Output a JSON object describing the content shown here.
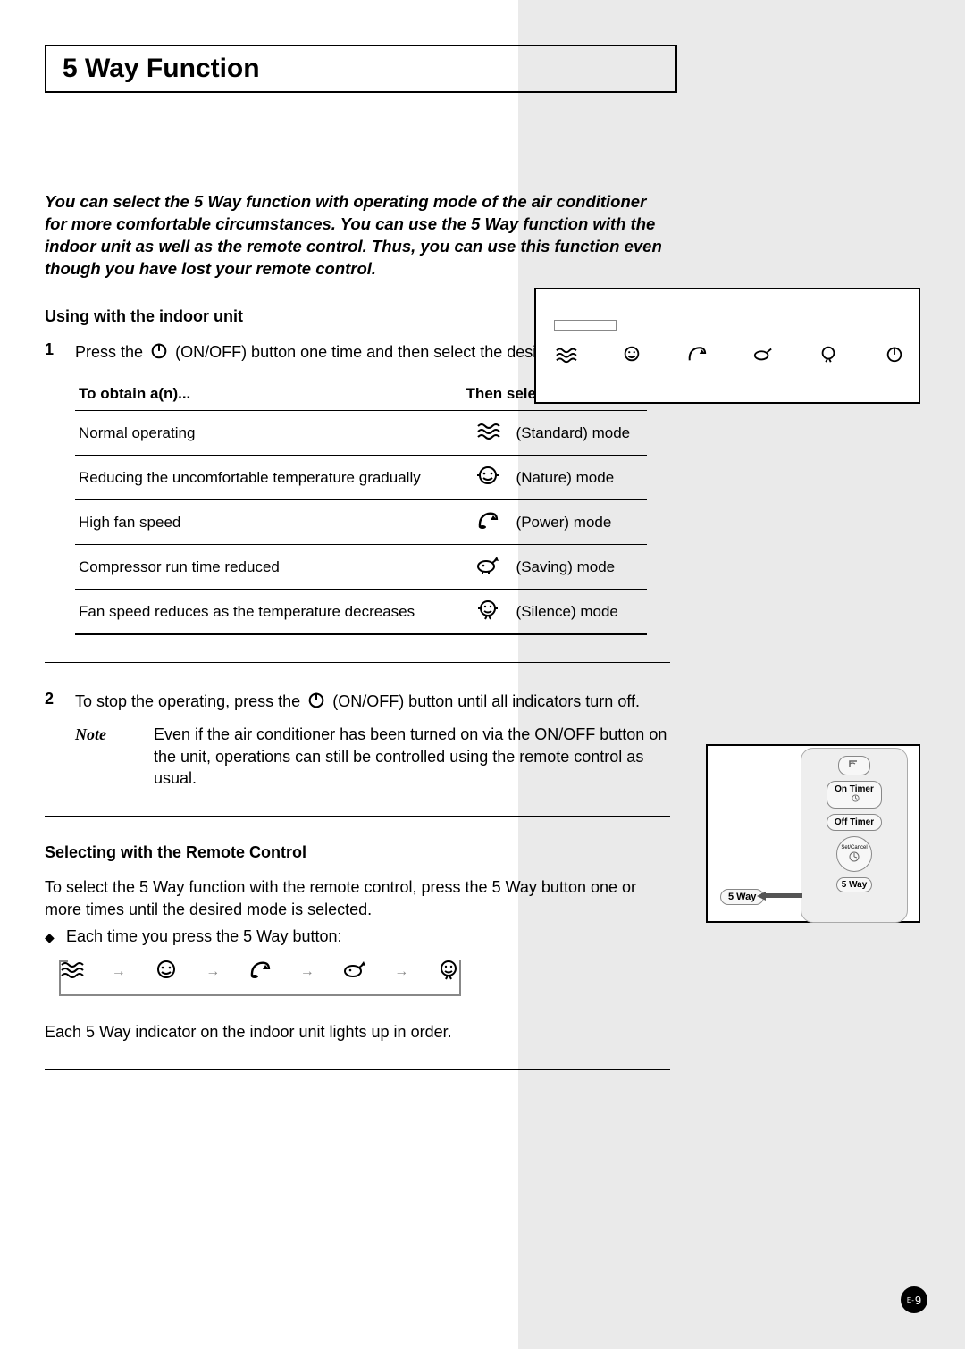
{
  "title": "5 Way Function",
  "intro": "You can select the 5 Way function with operating mode of the air conditioner for more comfortable circumstances. You can use the 5 Way function with the indoor unit as well as the remote control. Thus, you can use this function even though you have lost your remote control.",
  "section_indoor_heading": "Using with the indoor unit",
  "step1_pre": "Press the",
  "step1_post": "(ON/OFF) button one time and then select the desired mode.",
  "table": {
    "col1": "To obtain a(n)...",
    "col2": "Then select...",
    "rows": [
      {
        "obtain": "Normal operating",
        "mode": "(Standard) mode"
      },
      {
        "obtain": "Reducing the uncomfortable temperature gradually",
        "mode": "(Nature) mode"
      },
      {
        "obtain": "High fan speed",
        "mode": "(Power) mode"
      },
      {
        "obtain": "Compressor run time reduced",
        "mode": "(Saving) mode"
      },
      {
        "obtain": "Fan speed reduces as the temperature decreases",
        "mode": "(Silence) mode"
      }
    ]
  },
  "step2_pre": "To stop the operating, press the",
  "step2_post": "(ON/OFF) button until all indicators turn off.",
  "note_label": "Note",
  "note_body": "Even if the air conditioner has been turned on via the ON/OFF button on the unit, operations can still be controlled using the remote control as usual.",
  "section_remote_heading": "Selecting with the Remote Control",
  "remote_para": "To select the 5 Way function with the remote control, press the 5 Way button one or more times until the desired mode is selected.",
  "remote_bullet": "Each time you press the 5 Way button:",
  "remote_after": "Each 5 Way indicator on the indoor unit lights up in order.",
  "remote_buttons": {
    "on_timer": "On Timer",
    "off_timer": "Off Timer",
    "five_way": "5 Way"
  },
  "page_prefix": "E-",
  "page_num": "9"
}
